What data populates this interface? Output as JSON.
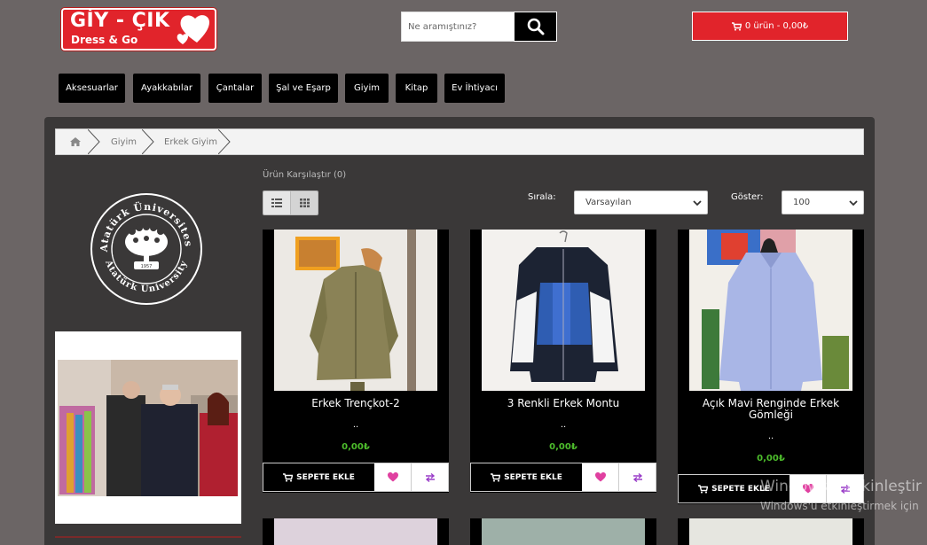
{
  "header": {
    "logo_main": "GİY - ÇIK",
    "logo_sub": "Dress & Go",
    "search_placeholder": "Ne aramıştınız?",
    "cart_label": "0 ürün - 0,00₺"
  },
  "nav": {
    "items": [
      "Aksesuarlar",
      "Ayakkabılar",
      "Çantalar",
      "Şal ve Eşarp",
      "Giyim",
      "Kitap",
      "Ev İhtiyacı"
    ]
  },
  "breadcrumb": {
    "home_icon": "home-icon",
    "items": [
      "Giyim",
      "Erkek Giyim"
    ]
  },
  "toolbar": {
    "compare_link": "Ürün Karşılaştır (0)",
    "sort_label": "Sırala:",
    "sort_value": "Varsayılan",
    "show_label": "Göster:",
    "show_value": "100"
  },
  "sidebar": {
    "seal_top_text": "Atatürk Üniversitesi",
    "seal_bottom_text": "Atatürk University",
    "seal_year": "1957"
  },
  "products": [
    {
      "title": "Erkek Trençkot-2",
      "dots": "..",
      "price": "0,00₺",
      "add_label": "SEPETE EKLE"
    },
    {
      "title": "3 Renkli Erkek Montu",
      "dots": "..",
      "price": "0,00₺",
      "add_label": "SEPETE EKLE"
    },
    {
      "title": "Açık Mavi Renginde Erkek Gömleği",
      "dots": "..",
      "price": "0,00₺",
      "add_label": "SEPETE EKLE"
    }
  ],
  "watermark": {
    "line1": "Windows'u Etkinleştir",
    "line2": "Windows'u etkinleştirmek için"
  },
  "colors": {
    "accent_red": "#e1242b",
    "price_green": "#4dbd2c",
    "wish_pink": "#e040a0",
    "compare_purple": "#9b3fc9"
  }
}
